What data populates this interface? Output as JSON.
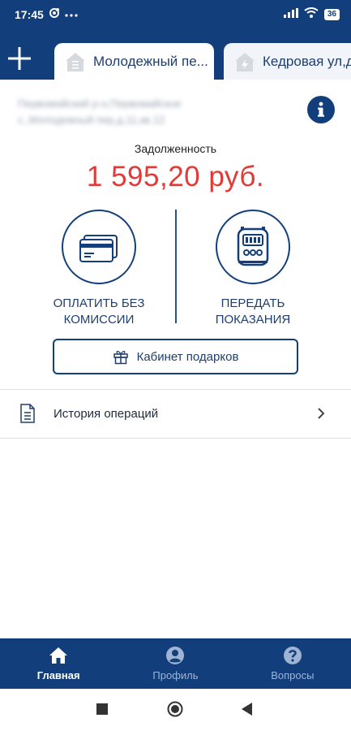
{
  "status_bar": {
    "time": "17:45",
    "battery": "36",
    "icons": [
      "notification-icon",
      "more-dots-icon",
      "signal-icon",
      "wifi-icon",
      "battery-icon"
    ]
  },
  "tabs": [
    {
      "label": "Молодежный пе...",
      "icon": "house-list-icon",
      "active": true
    },
    {
      "label": "Кедровая ул,д",
      "icon": "house-lightning-icon",
      "active": false
    }
  ],
  "account": {
    "address_line1": "Первомайский р-н,Первомайское",
    "address_line2": "с.,Молодежный пер,д.11,кв.12"
  },
  "debt": {
    "label": "Задолженность",
    "amount": "1 595,20 руб."
  },
  "actions": {
    "pay_line1": "Оплатить без",
    "pay_line2": "комиссии",
    "meters_line1": "Передать",
    "meters_line2": "показания"
  },
  "gift_button": {
    "label": "Кабинет подарков"
  },
  "history": {
    "label": "История операций"
  },
  "bottom_nav": [
    {
      "label": "Главная",
      "icon": "home-icon",
      "active": true
    },
    {
      "label": "Профиль",
      "icon": "profile-icon",
      "active": false
    },
    {
      "label": "Вопросы",
      "icon": "question-icon",
      "active": false
    }
  ],
  "colors": {
    "primary": "#123f7c",
    "debt": "#e23a36",
    "background": "#ffffff"
  }
}
